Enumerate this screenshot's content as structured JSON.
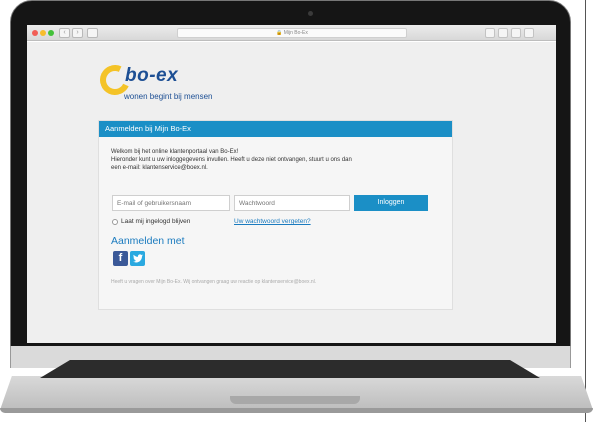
{
  "browser": {
    "url_text": "Mijn Bo-Ex"
  },
  "logo": {
    "name": "bo-ex",
    "tagline": "wonen begint bij mensen"
  },
  "login": {
    "header": "Aanmelden bij Mijn Bo-Ex",
    "intro_line1": "Welkom bij het online klantenportaal van Bo-Ex!",
    "intro_line2": "Hieronder kunt u uw inloggegevens invullen. Heeft u deze niet ontvangen, stuurt u ons dan",
    "intro_line3": "een e-mail: klantenservice@boex.nl.",
    "email_placeholder": "E-mail of gebruikersnaam",
    "password_placeholder": "Wachtwoord",
    "login_button": "Inloggen",
    "remember_label": "Laat mij ingelogd blijven",
    "forgot_link": "Uw wachtwoord vergeten?",
    "social_title": "Aanmelden met",
    "facebook_glyph": "f",
    "footer_note": "Heeft u vragen over Mijn Bo-Ex. Wij ontvangen graag uw reactie op klantenservice@boex.nl."
  },
  "icons": {
    "lock": "lock-icon",
    "facebook": "facebook-icon",
    "twitter": "twitter-icon"
  },
  "colors": {
    "header_blue": "#1b8fc6",
    "logo_yellow": "#f4c327",
    "logo_blue": "#1d4f94",
    "facebook": "#3b5998",
    "twitter": "#2aa9e0"
  }
}
